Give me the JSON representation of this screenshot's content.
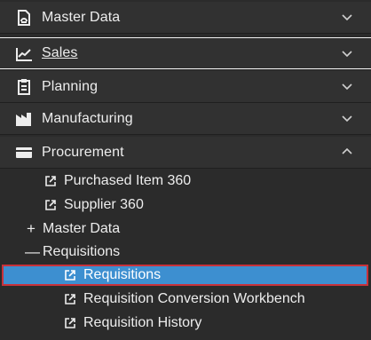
{
  "sections": {
    "master_data": {
      "label": "Master Data",
      "icon": "document-icon",
      "state": "collapsed"
    },
    "sales": {
      "label": "Sales",
      "icon": "line-chart-icon",
      "state": "collapsed"
    },
    "planning": {
      "label": "Planning",
      "icon": "clipboard-icon",
      "state": "collapsed"
    },
    "manufacturing": {
      "label": "Manufacturing",
      "icon": "factory-icon",
      "state": "collapsed"
    },
    "procurement": {
      "label": "Procurement",
      "icon": "card-icon",
      "state": "expanded"
    }
  },
  "procurement_items": {
    "purchased_item_360": "Purchased Item 360",
    "supplier_360": "Supplier 360",
    "master_data": {
      "sign": "+",
      "label": "Master Data"
    },
    "requisitions_group": {
      "sign": "—",
      "label": "Requisitions"
    }
  },
  "requisitions_items": {
    "requisitions": "Requisitions",
    "conversion_workbench": "Requisition Conversion Workbench",
    "history": "Requisition History"
  },
  "colors": {
    "background": "#2b2b2b",
    "header_background": "#313131",
    "selected_background": "#3d8fd0",
    "selected_border": "#c8323b",
    "text": "#ededed"
  }
}
